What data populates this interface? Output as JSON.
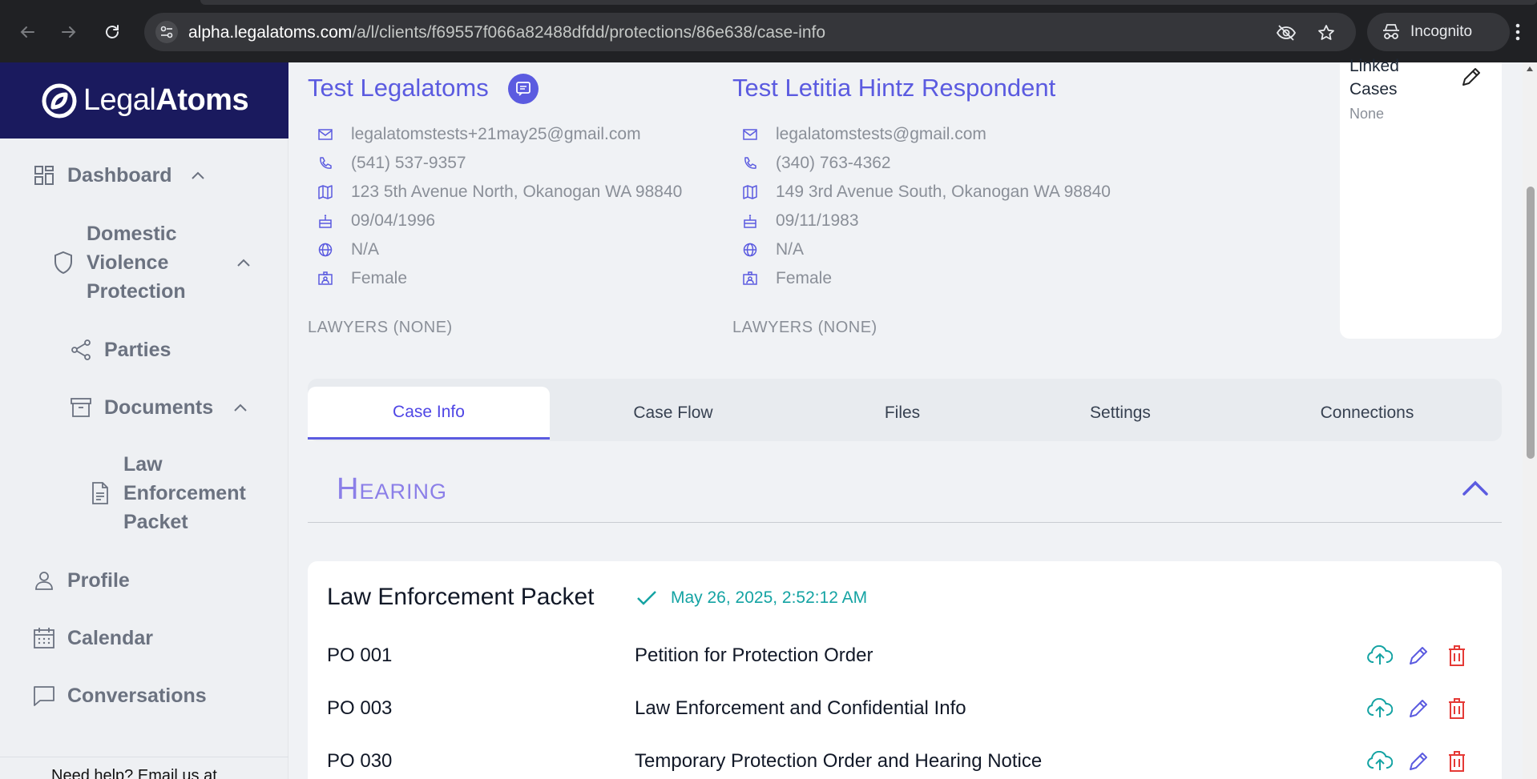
{
  "browser": {
    "url_host": "alpha.legalatoms.com",
    "url_path": "/a/l/clients/f69557f066a82488dfdd/protections/86e638/case-info",
    "incognito_label": "Incognito"
  },
  "sidebar": {
    "brand_light": "Legal",
    "brand_bold": "Atoms",
    "dashboard": "Dashboard",
    "dv_protection": [
      "Domestic",
      "Violence",
      "Protection"
    ],
    "parties": "Parties",
    "documents": "Documents",
    "law_packet": [
      "Law",
      "Enforcement",
      "Packet"
    ],
    "profile": "Profile",
    "calendar": "Calendar",
    "conversations": "Conversations",
    "help": "Need help? Email us at"
  },
  "petitioner": {
    "name": "Test Legalatoms",
    "email": "legalatomstests+21may25@gmail.com",
    "phone": "(541) 537-9357",
    "address": "123 5th Avenue North, Okanogan WA 98840",
    "dob": "09/04/1996",
    "language": "N/A",
    "gender": "Female",
    "lawyers": "LAWYERS (NONE)"
  },
  "respondent": {
    "name": "Test Letitia Hintz Respondent",
    "email": "legalatomstests@gmail.com",
    "phone": "(340) 763-4362",
    "address": "149 3rd Avenue South, Okanogan WA 98840",
    "dob": "09/11/1983",
    "language": "N/A",
    "gender": "Female",
    "lawyers": "LAWYERS (NONE)"
  },
  "linked_cases": {
    "title_1": "Linked",
    "title_2": "Cases",
    "value": "None"
  },
  "tabs": [
    "Case Info",
    "Case Flow",
    "Files",
    "Settings",
    "Connections"
  ],
  "section": {
    "title": "Hearing"
  },
  "packet": {
    "title": "Law Enforcement Packet",
    "date": "May 26, 2025, 2:52:12 AM",
    "documents": [
      {
        "code": "PO 001",
        "name": "Petition for Protection Order"
      },
      {
        "code": "PO 003",
        "name": "Law Enforcement and Confidential Info"
      },
      {
        "code": "PO 030",
        "name": "Temporary Protection Order and Hearing Notice"
      }
    ]
  },
  "colors": {
    "brand": "#1a1a5e",
    "accent": "#5b5be0",
    "teal": "#14a3a3",
    "delete": "#e53935"
  }
}
